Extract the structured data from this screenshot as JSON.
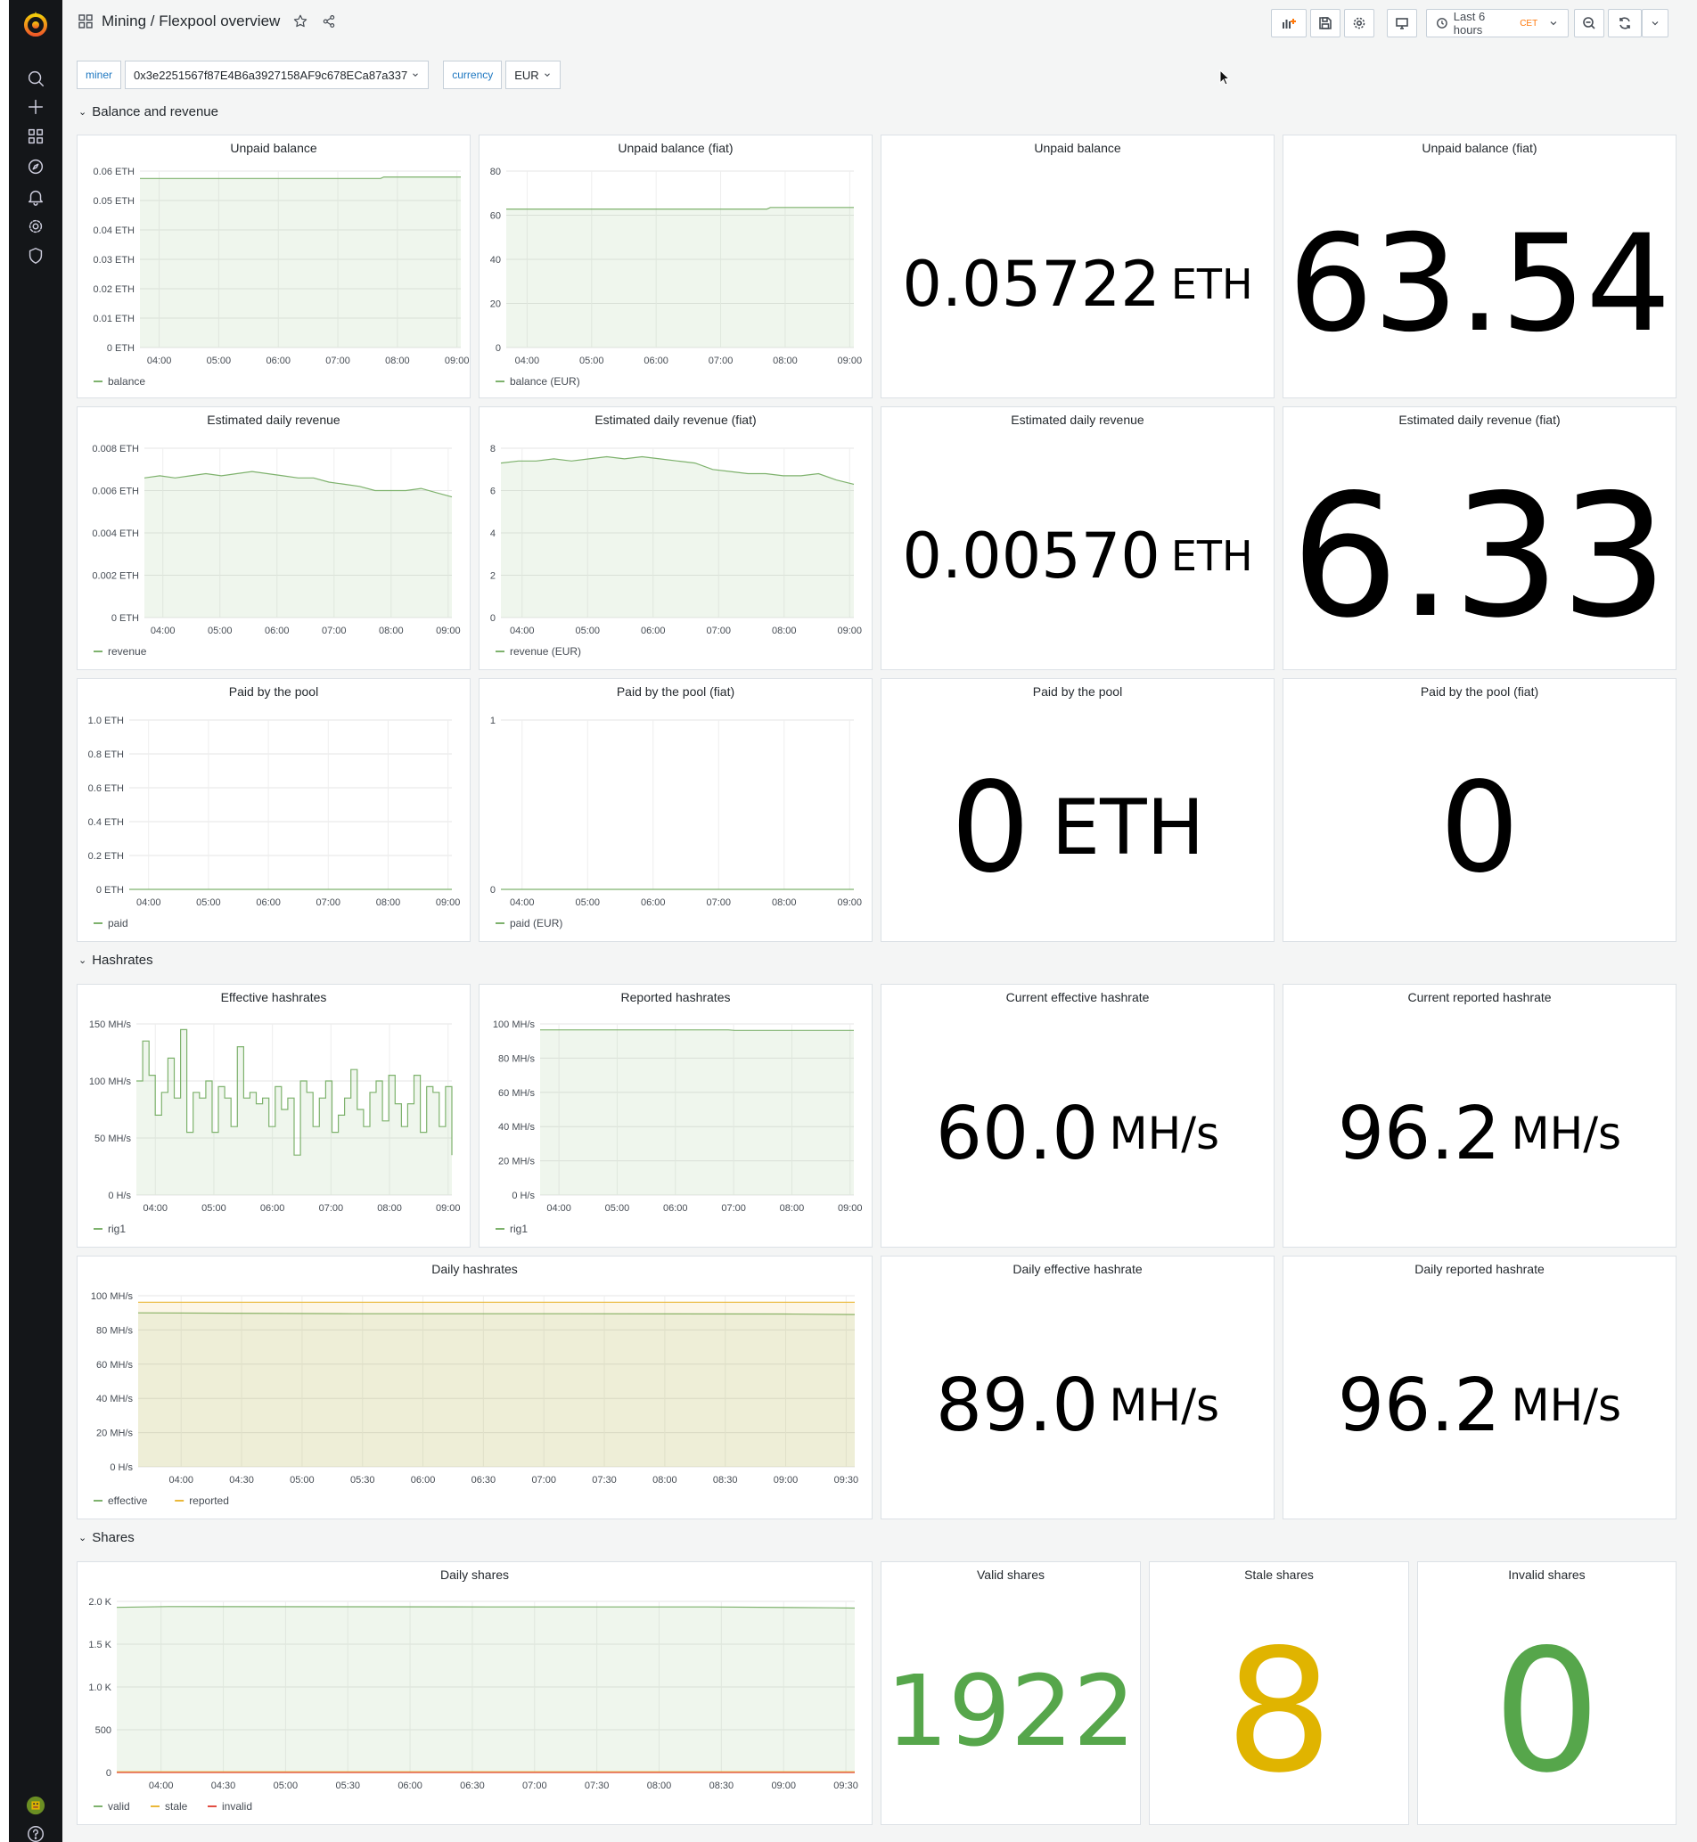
{
  "header": {
    "title": "Mining / Flexpool overview",
    "time_range": "Last 6 hours",
    "timezone": "CET"
  },
  "variables": [
    {
      "label": "miner",
      "value": "0x3e2251567f87E4B6a3927158AF9c678ECa87a337"
    },
    {
      "label": "currency",
      "value": "EUR"
    }
  ],
  "rows": {
    "balance": "Balance and revenue",
    "hashrates": "Hashrates",
    "shares": "Shares"
  },
  "colors": {
    "series_green": "#7eb26d",
    "series_yellow": "#eab839",
    "series_red": "#e24d42",
    "stat_green": "#56a64b",
    "stat_yellow": "#e0b400"
  },
  "panels": {
    "unpaid_stat": {
      "title": "Unpaid balance",
      "value": "0.05722",
      "unit": "ETH"
    },
    "unpaid_fiat_stat": {
      "title": "Unpaid balance (fiat)",
      "value": "63.54",
      "unit": ""
    },
    "revenue_stat": {
      "title": "Estimated daily revenue",
      "value": "0.00570",
      "unit": "ETH"
    },
    "revenue_fiat_stat": {
      "title": "Estimated daily revenue (fiat)",
      "value": "6.33",
      "unit": ""
    },
    "paid_stat": {
      "title": "Paid by the pool",
      "value": "0",
      "unit": "ETH"
    },
    "paid_fiat_stat": {
      "title": "Paid by the pool (fiat)",
      "value": "0",
      "unit": ""
    },
    "cur_eff_stat": {
      "title": "Current effective hashrate",
      "value": "60.0",
      "unit": "MH/s"
    },
    "cur_rep_stat": {
      "title": "Current reported hashrate",
      "value": "96.2",
      "unit": "MH/s"
    },
    "daily_eff_stat": {
      "title": "Daily effective hashrate",
      "value": "89.0",
      "unit": "MH/s"
    },
    "daily_rep_stat": {
      "title": "Daily reported hashrate",
      "value": "96.2",
      "unit": "MH/s"
    },
    "valid_stat": {
      "title": "Valid shares",
      "value": "1922",
      "unit": ""
    },
    "stale_stat": {
      "title": "Stale shares",
      "value": "8",
      "unit": ""
    },
    "invalid_stat": {
      "title": "Invalid shares",
      "value": "0",
      "unit": ""
    }
  },
  "chart_data": [
    {
      "id": "unpaid",
      "type": "area",
      "title": "Unpaid balance",
      "x_ticks": [
        "04:00",
        "05:00",
        "06:00",
        "07:00",
        "08:00",
        "09:00"
      ],
      "y_ticks": [
        "0 ETH",
        "0.01 ETH",
        "0.02 ETH",
        "0.03 ETH",
        "0.04 ETH",
        "0.05 ETH",
        "0.06 ETH"
      ],
      "ylim": [
        0,
        0.06
      ],
      "series": [
        {
          "name": "balance",
          "color": "#7eb26d",
          "fill": true,
          "x": [
            0,
            0.75,
            0.76,
            1
          ],
          "y": [
            0.0575,
            0.0575,
            0.058,
            0.058
          ]
        }
      ]
    },
    {
      "id": "unpaid_fiat",
      "type": "area",
      "title": "Unpaid balance (fiat)",
      "x_ticks": [
        "04:00",
        "05:00",
        "06:00",
        "07:00",
        "08:00",
        "09:00"
      ],
      "y_ticks": [
        "0",
        "20",
        "40",
        "60",
        "80"
      ],
      "ylim": [
        0,
        80
      ],
      "series": [
        {
          "name": "balance (EUR)",
          "color": "#7eb26d",
          "fill": true,
          "x": [
            0,
            0.75,
            0.76,
            1
          ],
          "y": [
            62.8,
            62.8,
            63.5,
            63.5
          ]
        }
      ]
    },
    {
      "id": "revenue",
      "type": "area",
      "title": "Estimated daily revenue",
      "x_ticks": [
        "04:00",
        "05:00",
        "06:00",
        "07:00",
        "08:00",
        "09:00"
      ],
      "y_ticks": [
        "0 ETH",
        "0.002 ETH",
        "0.004 ETH",
        "0.006 ETH",
        "0.008 ETH"
      ],
      "ylim": [
        0,
        0.008
      ],
      "series": [
        {
          "name": "revenue",
          "color": "#7eb26d",
          "fill": true,
          "x": [
            0,
            0.05,
            0.1,
            0.15,
            0.2,
            0.25,
            0.3,
            0.35,
            0.4,
            0.45,
            0.5,
            0.55,
            0.6,
            0.65,
            0.7,
            0.75,
            0.8,
            0.85,
            0.9,
            0.95,
            1
          ],
          "y": [
            0.0066,
            0.0067,
            0.0066,
            0.0067,
            0.0068,
            0.0067,
            0.0068,
            0.0069,
            0.0068,
            0.0067,
            0.0066,
            0.0066,
            0.0064,
            0.0063,
            0.0062,
            0.006,
            0.006,
            0.006,
            0.0061,
            0.0059,
            0.0057
          ]
        }
      ]
    },
    {
      "id": "revenue_fiat",
      "type": "area",
      "title": "Estimated daily revenue (fiat)",
      "x_ticks": [
        "04:00",
        "05:00",
        "06:00",
        "07:00",
        "08:00",
        "09:00"
      ],
      "y_ticks": [
        "0",
        "2",
        "4",
        "6",
        "8"
      ],
      "ylim": [
        0,
        8
      ],
      "series": [
        {
          "name": "revenue (EUR)",
          "color": "#7eb26d",
          "fill": true,
          "x": [
            0,
            0.05,
            0.1,
            0.15,
            0.2,
            0.25,
            0.3,
            0.35,
            0.4,
            0.45,
            0.5,
            0.55,
            0.6,
            0.65,
            0.7,
            0.75,
            0.8,
            0.85,
            0.9,
            0.95,
            1
          ],
          "y": [
            7.3,
            7.4,
            7.4,
            7.5,
            7.4,
            7.5,
            7.6,
            7.5,
            7.6,
            7.5,
            7.4,
            7.3,
            7.0,
            6.9,
            6.8,
            6.8,
            6.7,
            6.7,
            6.8,
            6.5,
            6.3
          ]
        }
      ]
    },
    {
      "id": "paid",
      "type": "line",
      "title": "Paid by the pool",
      "x_ticks": [
        "04:00",
        "05:00",
        "06:00",
        "07:00",
        "08:00",
        "09:00"
      ],
      "y_ticks": [
        "0 ETH",
        "0.2 ETH",
        "0.4 ETH",
        "0.6 ETH",
        "0.8 ETH",
        "1.0 ETH"
      ],
      "ylim": [
        0,
        1
      ],
      "series": [
        {
          "name": "paid",
          "color": "#7eb26d",
          "fill": false,
          "x": [
            0,
            1
          ],
          "y": [
            0,
            0
          ]
        }
      ]
    },
    {
      "id": "paid_fiat",
      "type": "line",
      "title": "Paid by the pool (fiat)",
      "x_ticks": [
        "04:00",
        "05:00",
        "06:00",
        "07:00",
        "08:00",
        "09:00"
      ],
      "y_ticks": [
        "0",
        "1"
      ],
      "ylim": [
        0,
        1
      ],
      "series": [
        {
          "name": "paid (EUR)",
          "color": "#7eb26d",
          "fill": false,
          "x": [
            0,
            1
          ],
          "y": [
            0,
            0
          ]
        }
      ]
    },
    {
      "id": "effective",
      "type": "area",
      "title": "Effective hashrates",
      "x_ticks": [
        "04:00",
        "05:00",
        "06:00",
        "07:00",
        "08:00",
        "09:00"
      ],
      "y_ticks": [
        "0 H/s",
        "50 MH/s",
        "100 MH/s",
        "150 MH/s"
      ],
      "ylim": [
        0,
        150
      ],
      "step": true,
      "series": [
        {
          "name": "rig1",
          "color": "#7eb26d",
          "fill": true,
          "x": [
            0,
            0.02,
            0.04,
            0.06,
            0.08,
            0.1,
            0.12,
            0.14,
            0.16,
            0.18,
            0.2,
            0.22,
            0.24,
            0.26,
            0.28,
            0.3,
            0.32,
            0.34,
            0.36,
            0.38,
            0.4,
            0.42,
            0.44,
            0.46,
            0.48,
            0.5,
            0.52,
            0.54,
            0.56,
            0.58,
            0.6,
            0.62,
            0.64,
            0.66,
            0.68,
            0.7,
            0.72,
            0.74,
            0.76,
            0.78,
            0.8,
            0.82,
            0.84,
            0.86,
            0.88,
            0.9,
            0.92,
            0.94,
            0.96,
            0.98,
            1
          ],
          "y": [
            100,
            135,
            105,
            70,
            90,
            120,
            85,
            145,
            55,
            90,
            85,
            100,
            55,
            95,
            85,
            60,
            130,
            85,
            90,
            80,
            85,
            60,
            95,
            75,
            85,
            35,
            100,
            90,
            60,
            85,
            100,
            55,
            70,
            85,
            110,
            75,
            60,
            90,
            100,
            65,
            105,
            80,
            60,
            80,
            105,
            55,
            95,
            90,
            60,
            95,
            35
          ]
        }
      ]
    },
    {
      "id": "reported",
      "type": "area",
      "title": "Reported hashrates",
      "x_ticks": [
        "04:00",
        "05:00",
        "06:00",
        "07:00",
        "08:00",
        "09:00"
      ],
      "y_ticks": [
        "0 H/s",
        "20 MH/s",
        "40 MH/s",
        "60 MH/s",
        "80 MH/s",
        "100 MH/s"
      ],
      "ylim": [
        0,
        100
      ],
      "series": [
        {
          "name": "rig1",
          "color": "#7eb26d",
          "fill": true,
          "x": [
            0,
            0.6,
            0.62,
            1
          ],
          "y": [
            96.5,
            96.5,
            96.2,
            96.2
          ]
        }
      ]
    },
    {
      "id": "daily_hash",
      "type": "area",
      "title": "Daily hashrates",
      "x_ticks": [
        "04:00",
        "04:30",
        "05:00",
        "05:30",
        "06:00",
        "06:30",
        "07:00",
        "07:30",
        "08:00",
        "08:30",
        "09:00",
        "09:30"
      ],
      "y_ticks": [
        "0 H/s",
        "20 MH/s",
        "40 MH/s",
        "60 MH/s",
        "80 MH/s",
        "100 MH/s"
      ],
      "ylim": [
        0,
        100
      ],
      "series": [
        {
          "name": "effective",
          "color": "#7eb26d",
          "fill": true,
          "x": [
            0,
            0.3,
            0.6,
            0.9,
            1
          ],
          "y": [
            90,
            89.5,
            89.5,
            89.3,
            89
          ]
        },
        {
          "name": "reported",
          "color": "#eab839",
          "fill": true,
          "x": [
            0,
            1
          ],
          "y": [
            96.2,
            96.2
          ]
        }
      ]
    },
    {
      "id": "daily_shares",
      "type": "area",
      "title": "Daily shares",
      "x_ticks": [
        "04:00",
        "04:30",
        "05:00",
        "05:30",
        "06:00",
        "06:30",
        "07:00",
        "07:30",
        "08:00",
        "08:30",
        "09:00",
        "09:30"
      ],
      "y_ticks": [
        "0",
        "500",
        "1.0 K",
        "1.5 K",
        "2.0 K"
      ],
      "ylim": [
        0,
        2000
      ],
      "series": [
        {
          "name": "valid",
          "color": "#7eb26d",
          "fill": true,
          "x": [
            0,
            0.07,
            0.5,
            0.8,
            0.97,
            1
          ],
          "y": [
            1930,
            1940,
            1935,
            1935,
            1925,
            1922
          ]
        },
        {
          "name": "stale",
          "color": "#eab839",
          "fill": false,
          "x": [
            0,
            1
          ],
          "y": [
            8,
            8
          ]
        },
        {
          "name": "invalid",
          "color": "#e24d42",
          "fill": false,
          "x": [
            0,
            1
          ],
          "y": [
            0,
            0
          ]
        }
      ]
    }
  ]
}
